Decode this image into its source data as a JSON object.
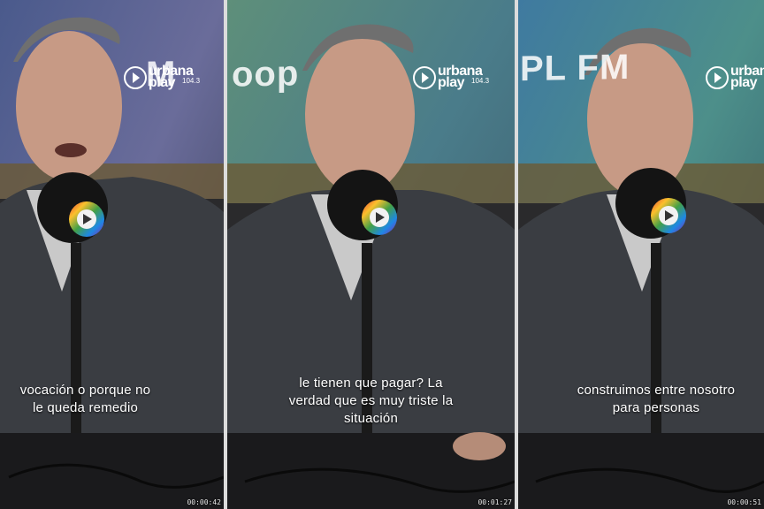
{
  "brand": {
    "logo_top": "urbana",
    "logo_freq": "104.3",
    "logo_bottom": "play",
    "accent_colors": [
      "#e53935",
      "#fbc02d",
      "#43a047",
      "#1e88e5",
      "#8e24aa"
    ]
  },
  "panels": [
    {
      "caption_lines": [
        "vocación o porque no",
        "le queda remedio"
      ],
      "timestamp": "00:00:42",
      "background_word": "M"
    },
    {
      "caption_lines": [
        "le tienen que pagar? La",
        "verdad que es muy triste la",
        "situación"
      ],
      "timestamp": "00:01:27",
      "background_word": "oop"
    },
    {
      "caption_lines": [
        "construimos entre nosotro",
        "para personas"
      ],
      "timestamp": "00:00:51",
      "background_word": "PL FM"
    }
  ]
}
